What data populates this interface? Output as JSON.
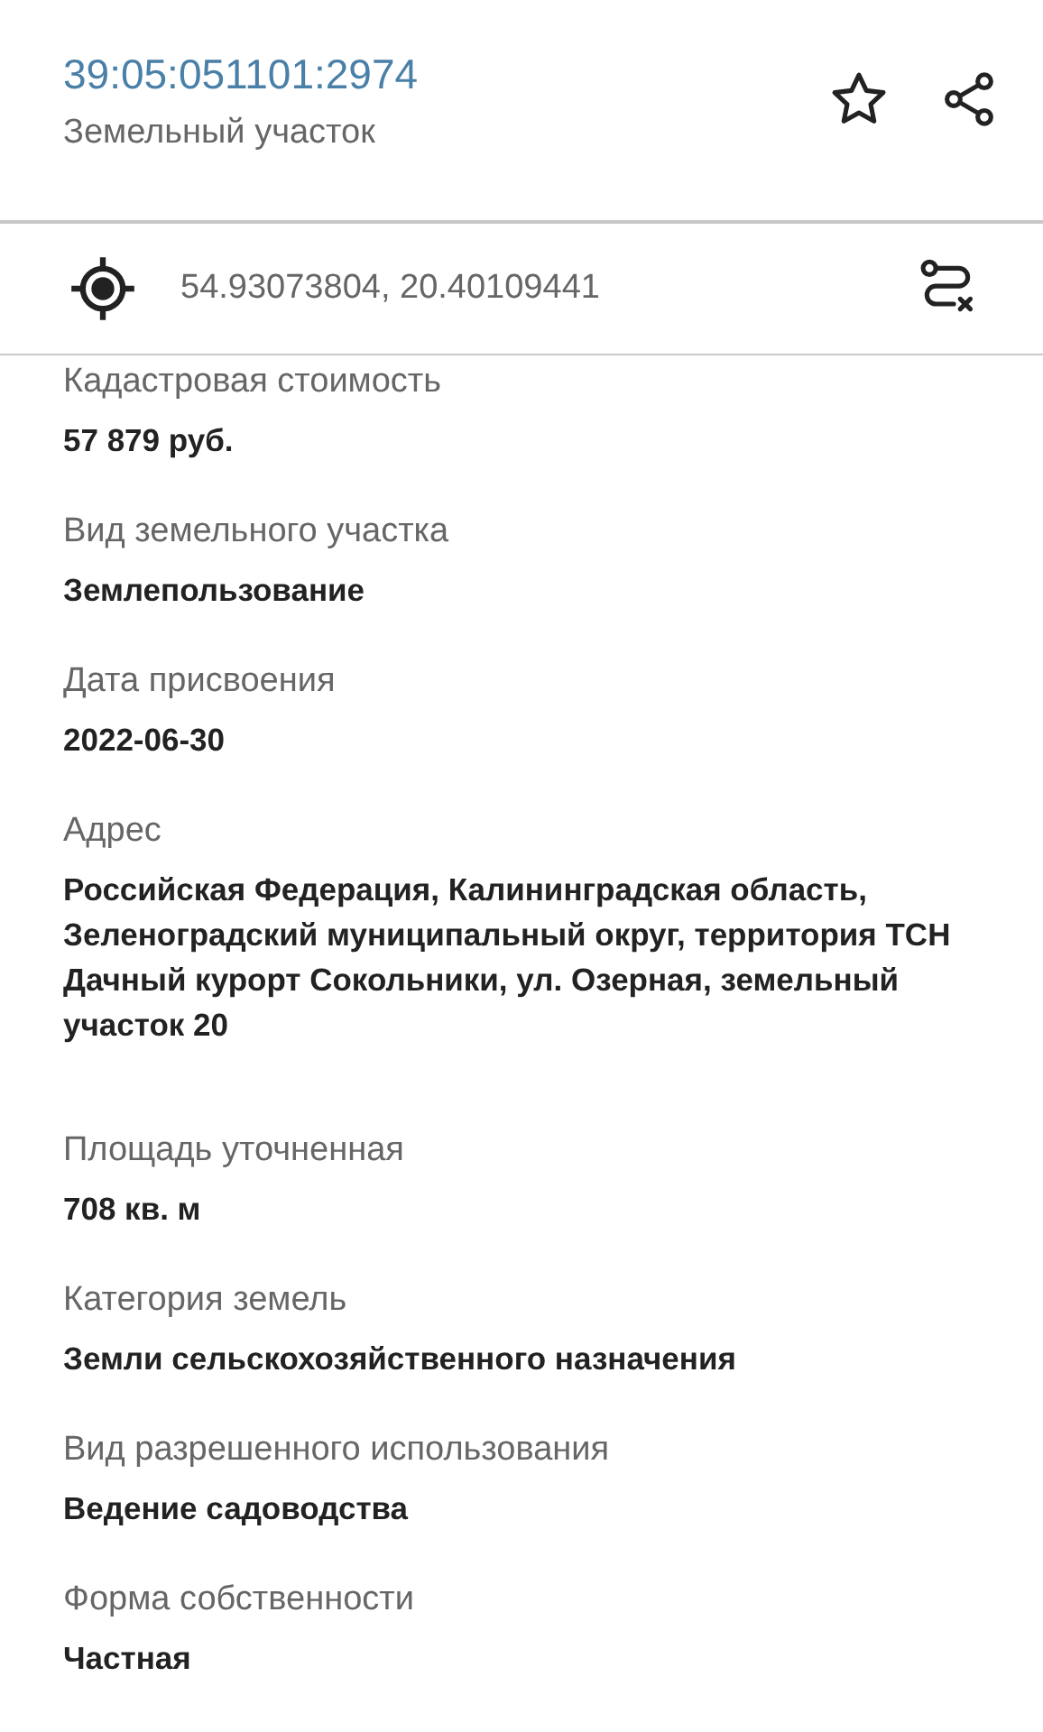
{
  "header": {
    "title": "39:05:051101:2974",
    "subtitle": "Земельный участок"
  },
  "coordinates": "54.93073804, 20.40109441",
  "fields": [
    {
      "label": "Кадастровая стоимость",
      "value": "57 879 руб."
    },
    {
      "label": "Вид земельного участка",
      "value": "Землепользование"
    },
    {
      "label": "Дата присвоения",
      "value": "2022-06-30"
    },
    {
      "label": "Адрес",
      "value": "Российская Федерация, Калининградская область, Зеленоградский муниципальный округ, территория ТСН Дачный курорт Сокольники, ул. Озерная, земельный участок 20"
    },
    {
      "label": "Площадь уточненная",
      "value": "708 кв. м"
    },
    {
      "label": "Категория земель",
      "value": "Земли сельскохозяйственного назначения"
    },
    {
      "label": "Вид разрешенного использования",
      "value": "Ведение садоводства"
    },
    {
      "label": "Форма собственности",
      "value": "Частная"
    }
  ]
}
